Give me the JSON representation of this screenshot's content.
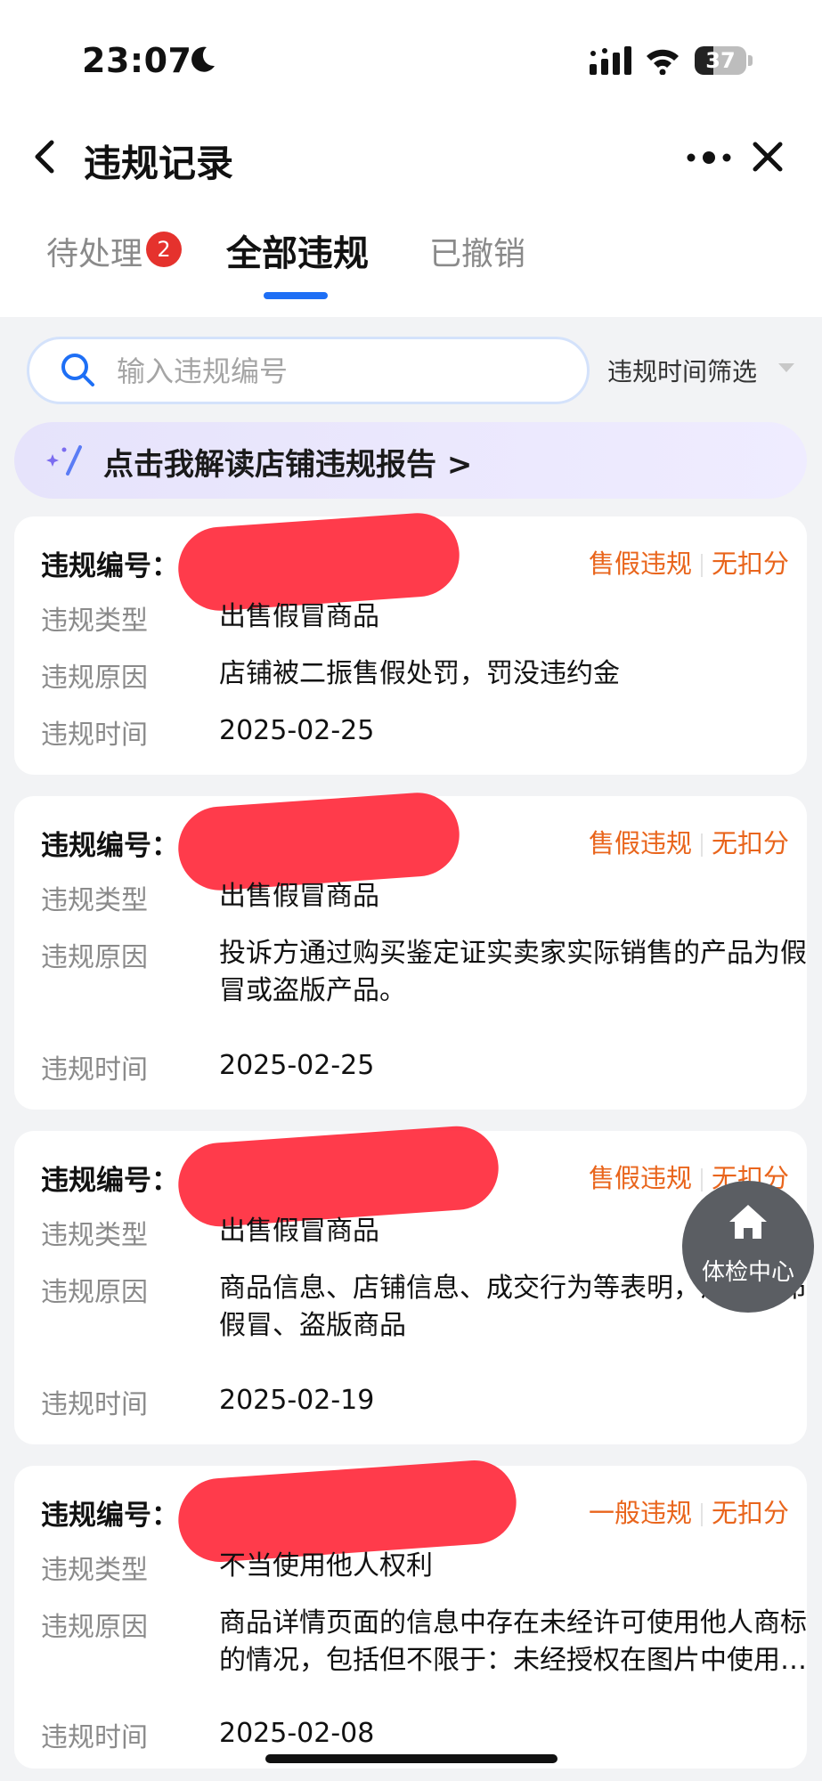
{
  "status_bar": {
    "time": "23:07",
    "battery": "37",
    "battery_level": 0.37
  },
  "header": {
    "title": "违规记录"
  },
  "tabs": [
    {
      "label": "待处理",
      "badge": "2"
    },
    {
      "label": "全部违规",
      "active": true
    },
    {
      "label": "已撤销"
    }
  ],
  "search": {
    "placeholder": "输入违规编号",
    "value": ""
  },
  "filter": {
    "label": "违规时间筛选"
  },
  "banner": {
    "text": "点击我解读店铺违规报告 >"
  },
  "labels": {
    "id": "违规编号：",
    "type": "违规类型",
    "reason": "违规原因",
    "time": "违规时间"
  },
  "records": [
    {
      "category": "售假违规",
      "points": "无扣分",
      "type": "出售假冒商品",
      "reason": "店铺被二振售假处罚，罚没违约金",
      "time": "2025-02-25"
    },
    {
      "category": "售假违规",
      "points": "无扣分",
      "type": "出售假冒商品",
      "reason": "投诉方通过购买鉴定证实卖家实际销售的产品为假冒或盗版产品。",
      "time": "2025-02-25"
    },
    {
      "category": "售假违规",
      "points": "无扣分",
      "type": "出售假冒商品",
      "reason": "商品信息、店铺信息、成交行为等表明，涉嫌发布假冒、盗版商品",
      "time": "2025-02-19"
    },
    {
      "category": "一般违规",
      "points": "无扣分",
      "type": "不当使用他人权利",
      "reason": "商品详情页面的信息中存在未经许可使用他人商标的情况，包括但不限于：未经授权在图片中使用他人商标",
      "time": "2025-02-08"
    }
  ],
  "fab": {
    "label": "体检中心"
  },
  "colors": {
    "accent": "#1e6ff5",
    "tag": "#e9651c",
    "badge": "#e5322d",
    "redaction": "#ff2a3c"
  }
}
